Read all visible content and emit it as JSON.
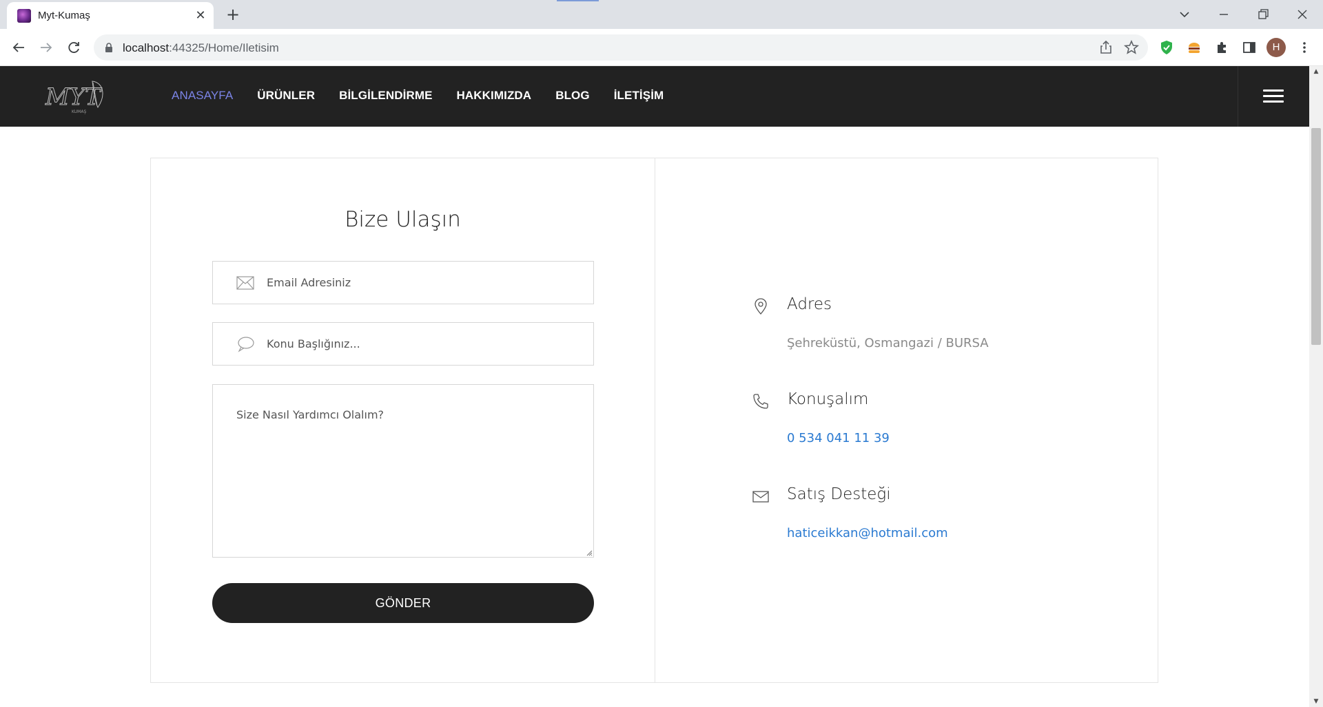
{
  "browser": {
    "tab_title": "Myt-Kumaş",
    "url_host": "localhost",
    "url_rest": ":44325/Home/Iletisim",
    "profile_initial": "H"
  },
  "header": {
    "nav": [
      {
        "label": "ANASAYFA",
        "active": true
      },
      {
        "label": "ÜRÜNLER",
        "active": false
      },
      {
        "label": "BİLGİLENDİRME",
        "active": false
      },
      {
        "label": "HAKKIMIZDA",
        "active": false
      },
      {
        "label": "BLOG",
        "active": false
      },
      {
        "label": "İLETİŞİM",
        "active": false
      }
    ]
  },
  "contact_form": {
    "title": "Bize Ulaşın",
    "email_placeholder": "Email Adresiniz",
    "subject_placeholder": "Konu Başlığınız...",
    "message_placeholder": "Size Nasıl Yardımcı Olalım?",
    "submit_label": "GÖNDER"
  },
  "contact_info": {
    "address_title": "Adres",
    "address_value": "Şehreküstü, Osmangazi / BURSA",
    "phone_title": "Konuşalım",
    "phone_value": "0 534 041 11 39",
    "support_title": "Satış Desteği",
    "support_value": "haticeikkan@hotmail.com"
  },
  "colors": {
    "header_bg": "#222222",
    "nav_active": "#7b84e6",
    "link": "#2a7ad1",
    "button_bg": "#222222"
  }
}
